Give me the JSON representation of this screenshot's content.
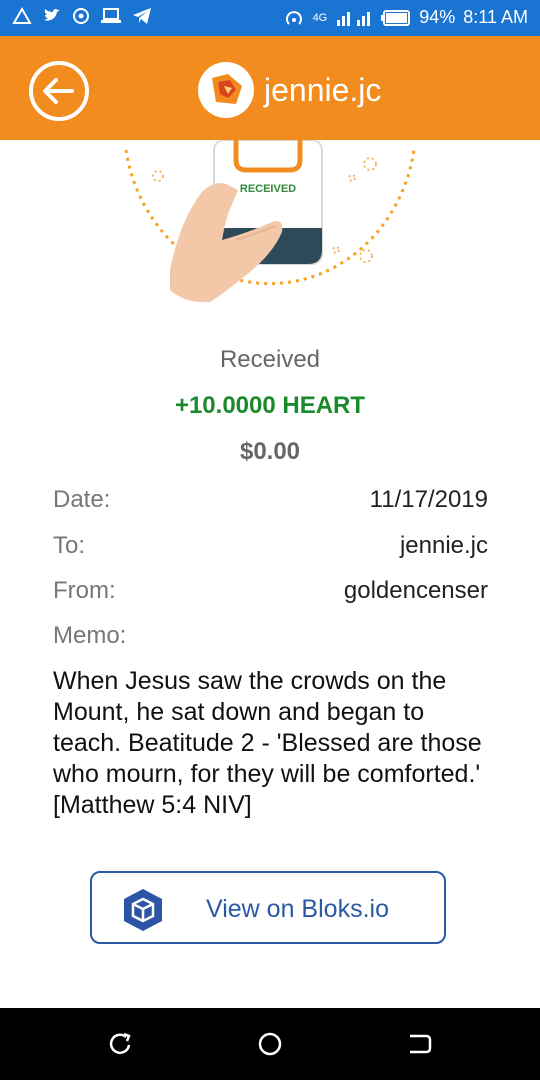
{
  "status_bar": {
    "network": "4G",
    "battery": "94%",
    "time": "8:11 AM"
  },
  "header": {
    "title": "jennie.jc"
  },
  "illustration": {
    "phone_text": "RECEIVED"
  },
  "transaction": {
    "status": "Received",
    "amount": "+10.0000 HEART",
    "usd_value": "$0.00"
  },
  "details": {
    "date_label": "Date:",
    "date_value": "11/17/2019",
    "to_label": "To:",
    "to_value": "jennie.jc",
    "from_label": "From:",
    "from_value": "goldencenser",
    "memo_label": "Memo:",
    "memo_text": "When Jesus saw the crowds on the Mount, he sat down and began to teach. Beatitude 2 - 'Blessed are those who mourn, for they will be comforted.' [Matthew 5:4 NIV]"
  },
  "actions": {
    "bloks_label": "View on Bloks.io"
  },
  "colors": {
    "status_bar": "#1a74d2",
    "app_bar": "#f28c1f",
    "amount_green": "#1b8a2b",
    "bloks_blue": "#2a5aa5"
  },
  "icons": [
    "back-arrow-icon",
    "app-logo-icon",
    "bloks-cube-icon",
    "recent-apps-icon",
    "home-icon",
    "back-nav-icon"
  ]
}
